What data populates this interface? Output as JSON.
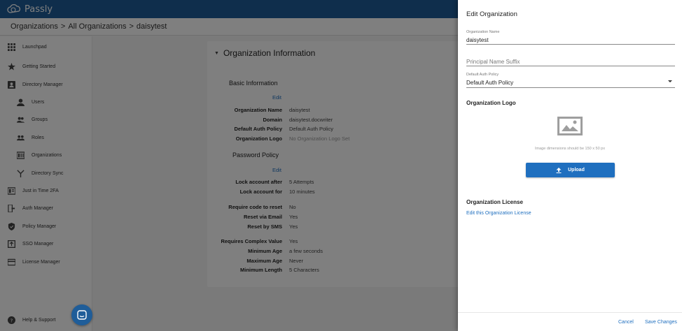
{
  "app": {
    "name": "Passly"
  },
  "breadcrumb": [
    "Organizations",
    ">",
    "All Organizations",
    ">",
    "daisytest"
  ],
  "sidebar": {
    "items": [
      {
        "label": "Launchpad",
        "icon": "grid-icon"
      },
      {
        "label": "Getting Started",
        "icon": "star-icon"
      },
      {
        "label": "Directory Manager",
        "icon": "contact-card-icon"
      },
      {
        "label": "Users",
        "icon": "person-icon"
      },
      {
        "label": "Groups",
        "icon": "people-icon"
      },
      {
        "label": "Roles",
        "icon": "roles-icon"
      },
      {
        "label": "Organizations",
        "icon": "org-card-icon"
      },
      {
        "label": "Directory Sync",
        "icon": "sync-fork-icon"
      },
      {
        "label": "Just in Time 2FA",
        "icon": "badge-icon"
      },
      {
        "label": "Auth Manager",
        "icon": "phone-key-icon"
      },
      {
        "label": "Policy Manager",
        "icon": "shield-icon"
      },
      {
        "label": "SSO Manager",
        "icon": "sso-box-icon"
      },
      {
        "label": "License Manager",
        "icon": "credit-card-icon"
      }
    ],
    "help_label": "Help & Support"
  },
  "card": {
    "title": "Organization Information",
    "basic": {
      "title": "Basic Information",
      "edit": "Edit",
      "rows": [
        {
          "label": "Organization Name",
          "value": "daisytest"
        },
        {
          "label": "Domain",
          "value": "daisytest.docwriter"
        },
        {
          "label": "Default Auth Policy",
          "value": "Default Auth Policy"
        },
        {
          "label": "Organization Logo",
          "value": "No Organization Logo Set"
        }
      ]
    },
    "password": {
      "title": "Password Policy",
      "edit": "Edit",
      "rows": [
        {
          "label": "Lock account after",
          "value": "5 Attempts"
        },
        {
          "label": "Lock account for",
          "value": "10 minutes"
        },
        {
          "label": "Require code to reset",
          "value": "No"
        },
        {
          "label": "Reset via Email",
          "value": "Yes"
        },
        {
          "label": "Reset by SMS",
          "value": "Yes"
        },
        {
          "label": "Requires Complex Value",
          "value": "Yes"
        },
        {
          "label": "Minimum Age",
          "value": "a few seconds"
        },
        {
          "label": "Maximum Age",
          "value": "Never"
        },
        {
          "label": "Minimum Length",
          "value": "5 Characters"
        }
      ]
    }
  },
  "drawer": {
    "title": "Edit Organization",
    "org_name_label": "Organization Name",
    "org_name_value": "daisytest",
    "suffix_placeholder": "Principal Name Suffix",
    "auth_policy_label": "Default Auth Policy",
    "auth_policy_value": "Default Auth Policy",
    "logo_section": "Organization Logo",
    "logo_hint": "Image dimensions should be 150 x 50 px",
    "upload_label": "Upload",
    "license_section": "Organization License",
    "license_link": "Edit this Organization License",
    "cancel_label": "Cancel",
    "save_label": "Save Changes"
  },
  "colors": {
    "brand": "#1f5d99",
    "accent": "#1f6fbf"
  }
}
